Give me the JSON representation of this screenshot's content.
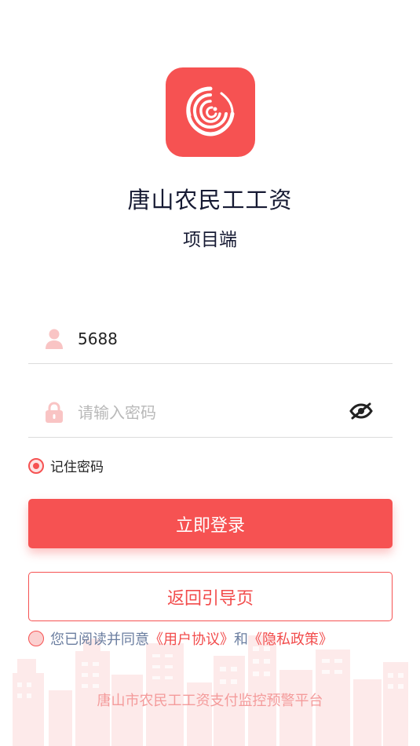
{
  "app": {
    "title": "唐山农民工工资",
    "subtitle": "项目端"
  },
  "login_form": {
    "username_value": "5688",
    "username_icon": "user-icon",
    "password_placeholder": "请输入密码",
    "password_icon": "lock-icon",
    "visibility_icon": "eye-off-icon",
    "remember_label": "记住密码",
    "remember_checked": true
  },
  "buttons": {
    "login_label": "立即登录",
    "back_label": "返回引导页"
  },
  "agreement": {
    "checked": false,
    "prefix": "您已阅读并同意",
    "user_agreement": "《用户协议》",
    "conjunction": "和",
    "privacy_policy": "《隐私政策》"
  },
  "footer": {
    "platform_name": "唐山市农民工工资支付监控预警平台"
  },
  "colors": {
    "brand": "#f65252",
    "link": "#f24c4c",
    "muted_text": "#6b7ea0",
    "footer_text": "#f49b9b"
  }
}
